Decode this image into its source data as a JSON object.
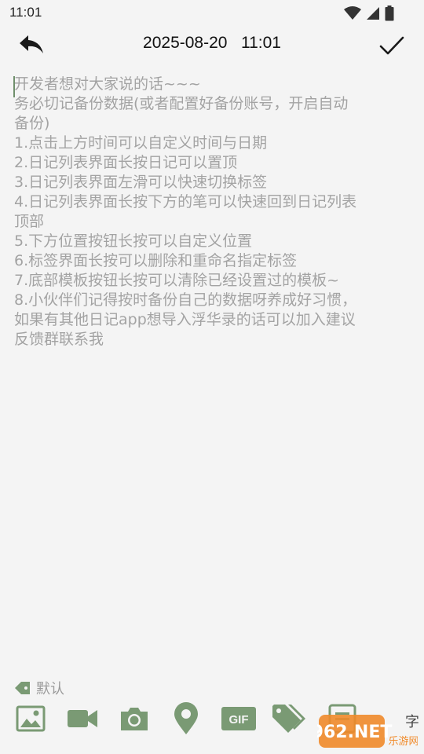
{
  "status_bar": {
    "time": "11:01",
    "icons": [
      "wifi-icon",
      "signal-icon",
      "battery-icon"
    ]
  },
  "toolbar": {
    "back_icon": "back-arrow-icon",
    "datetime": "2025-08-20   11:01",
    "confirm_icon": "check-icon"
  },
  "editor": {
    "placeholder_lines": [
      "开发者想对大家说的话~~~",
      "务必切记备份数据(或者配置好备份账号，开启自动",
      "备份)",
      "1.点击上方时间可以自定义时间与日期",
      "2.日记列表界面长按日记可以置顶",
      "3.日记列表界面左滑可以快速切换标签",
      "4.日记列表界面长按下方的笔可以快速回到日记列表",
      "顶部",
      "5.下方位置按钮长按可以自定义位置",
      "6.标签界面长按可以删除和重命名指定标签",
      "7.底部模板按钮长按可以清除已经设置过的模板~",
      "8.小伙伴们记得按时备份自己的数据呀养成好习惯，",
      "如果有其他日记app想导入浮华录的话可以加入建议",
      "反馈群联系我"
    ]
  },
  "tag": {
    "icon": "tag-icon",
    "label": "默认"
  },
  "bottom_toolbar": {
    "items": [
      "image-icon",
      "video-icon",
      "camera-icon",
      "location-icon",
      "gif-icon",
      "tags-icon",
      "template-icon"
    ],
    "gif_text": "GIF",
    "word_count_suffix": "字"
  },
  "watermark": {
    "text": "962.NET",
    "subtext": "乐游网"
  },
  "colors": {
    "accent": "#7a9a74",
    "background": "#f4f4f4",
    "text_hint": "#a3a3a3"
  }
}
